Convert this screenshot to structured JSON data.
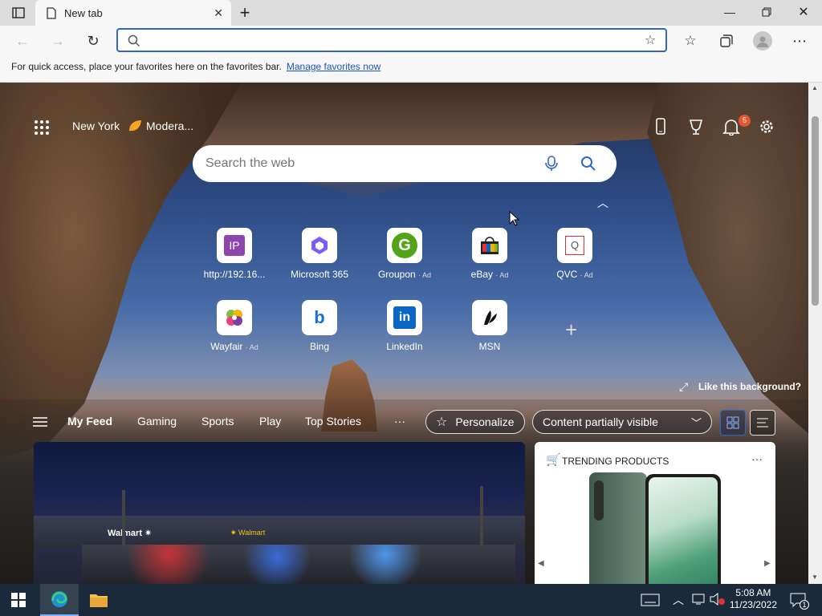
{
  "browser": {
    "tab_title": "New tab",
    "address_value": "",
    "favbar_text": "For quick access, place your favorites here on the favorites bar.",
    "favbar_link": "Manage favorites now"
  },
  "newtab": {
    "location": "New York",
    "weather": "Modera...",
    "notification_count": "5",
    "search_placeholder": "Search the web",
    "tiles": [
      {
        "label": "http://192.16...",
        "ad": "",
        "icon": "ip-icon"
      },
      {
        "label": "Microsoft 365",
        "ad": "",
        "icon": "microsoft365-icon"
      },
      {
        "label": "Groupon",
        "ad": "· Ad",
        "icon": "groupon-icon"
      },
      {
        "label": "eBay",
        "ad": "· Ad",
        "icon": "ebay-icon"
      },
      {
        "label": "QVC",
        "ad": "· Ad",
        "icon": "qvc-icon"
      },
      {
        "label": "Wayfair",
        "ad": "· Ad",
        "icon": "wayfair-icon"
      },
      {
        "label": "Bing",
        "ad": "",
        "icon": "bing-icon"
      },
      {
        "label": "LinkedIn",
        "ad": "",
        "icon": "linkedin-icon"
      },
      {
        "label": "MSN",
        "ad": "",
        "icon": "msn-icon"
      }
    ],
    "like_background": "Like this background?",
    "nav": [
      "My Feed",
      "Gaming",
      "Sports",
      "Play",
      "Top Stories"
    ],
    "personalize": "Personalize",
    "content_visibility": "Content partially visible",
    "trending_title": "TRENDING PRODUCTS"
  },
  "taskbar": {
    "time": "5:08 AM",
    "date": "11/23/2022",
    "notif_badge": "1"
  },
  "colors": {
    "accent": "#2f66c8",
    "badge": "#e8542c"
  }
}
